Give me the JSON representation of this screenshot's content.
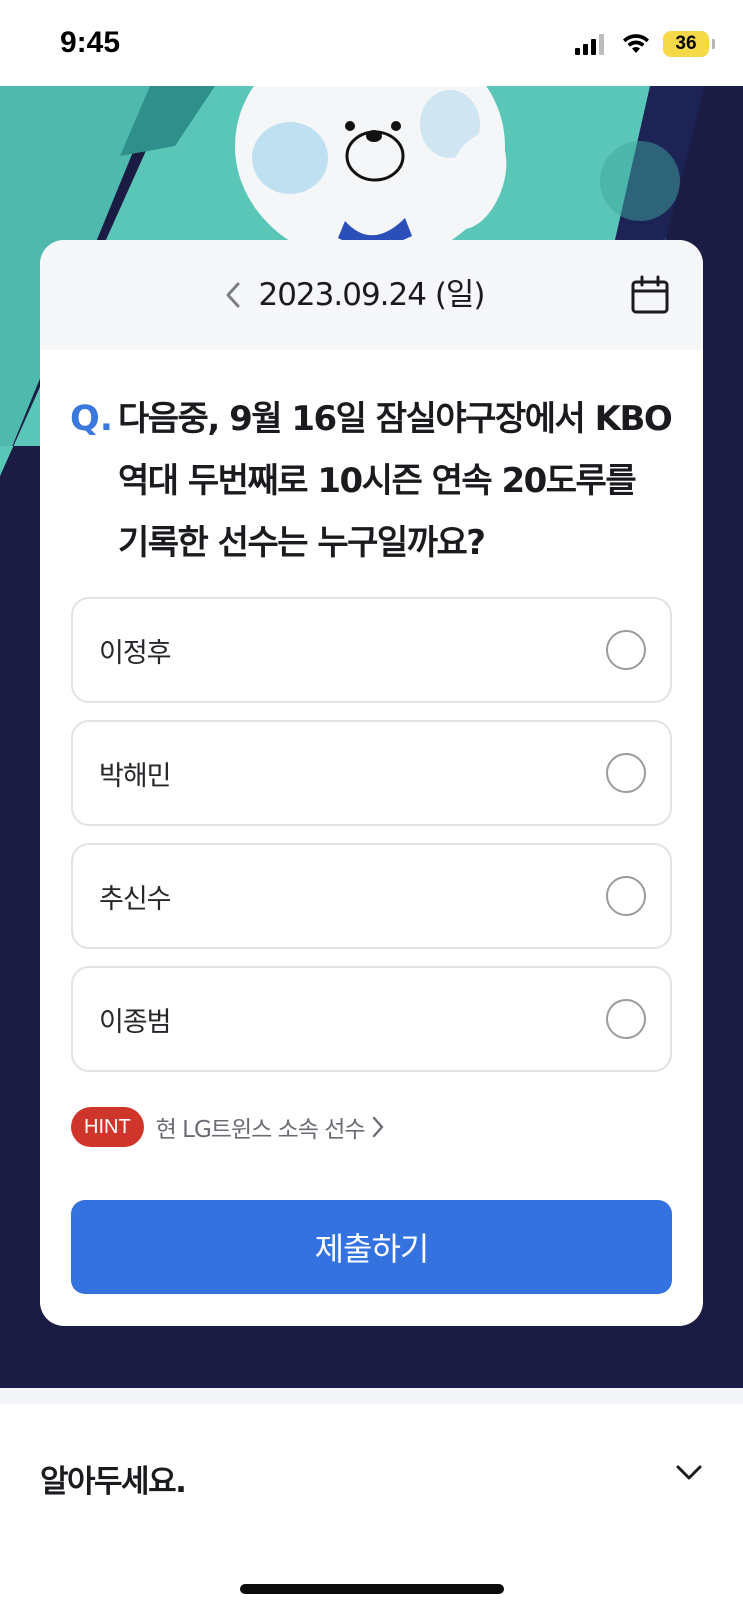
{
  "status_bar": {
    "time": "9:45",
    "battery": "36"
  },
  "header": {
    "date": "2023.09.24 (일)"
  },
  "question": {
    "prefix": "Q.",
    "text": "다음중, 9월 16일 잠실야구장에서 KBO 역대 두번째로 10시즌 연속 20도루를 기록한 선수는 누구일까요?"
  },
  "options": [
    {
      "label": "이정후",
      "selected": false
    },
    {
      "label": "박해민",
      "selected": false
    },
    {
      "label": "추신수",
      "selected": false
    },
    {
      "label": "이종범",
      "selected": false
    }
  ],
  "hint": {
    "badge": "HINT",
    "text": "현 LG트윈스 소속 선수"
  },
  "submit": {
    "label": "제출하기"
  },
  "notice": {
    "title": "알아두세요."
  },
  "icons": {
    "prev": "chevron-left-icon",
    "calendar": "calendar-icon",
    "hint_more": "chevron-right-icon",
    "notice_expand": "chevron-down-icon"
  },
  "colors": {
    "accent": "#3472e0",
    "question_mark": "#3b78dd",
    "hint_badge": "#d0352b",
    "hero_dark": "#1a1c44",
    "hero_teal": "#5ac6b8"
  }
}
